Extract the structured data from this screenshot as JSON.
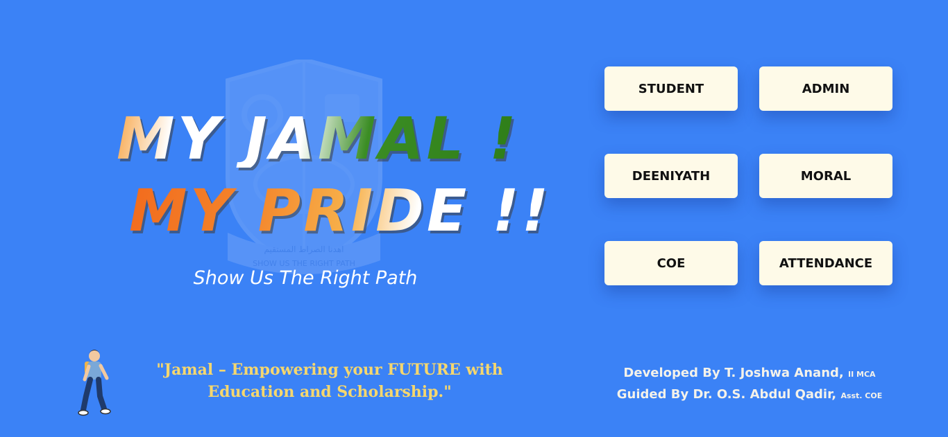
{
  "hero": {
    "line1": "MY JAMAL !",
    "line2": "MY PRIDE !!",
    "tagline": "Show Us The Right Path"
  },
  "buttons": {
    "student": "STUDENT",
    "admin": "ADMIN",
    "deeniyath": "DEENIYATH",
    "moral": "MORAL",
    "coe": "COE",
    "attendance": "ATTENDANCE"
  },
  "quote": {
    "line1": "\"Jamal – Empowering your FUTURE with",
    "line2": "Education and Scholarship.\""
  },
  "credits": {
    "developed": "Developed By T. Joshwa Anand,",
    "developed_role": "II MCA",
    "guided": "Guided By Dr. O.S. Abdul Qadir,",
    "guided_role": "Asst. COE"
  },
  "crest_text": {
    "arabic": "اهدنا الصراط المستقيم",
    "motto": "SHOW US THE RIGHT PATH"
  },
  "colors": {
    "background": "#3b82f6",
    "button_bg": "#fefae8",
    "quote": "#f5d76e",
    "saffron": "#f26b1d",
    "green": "#2e7d18"
  },
  "icons": {
    "crest": "college-crest-icon",
    "walker": "walking-student-icon"
  }
}
